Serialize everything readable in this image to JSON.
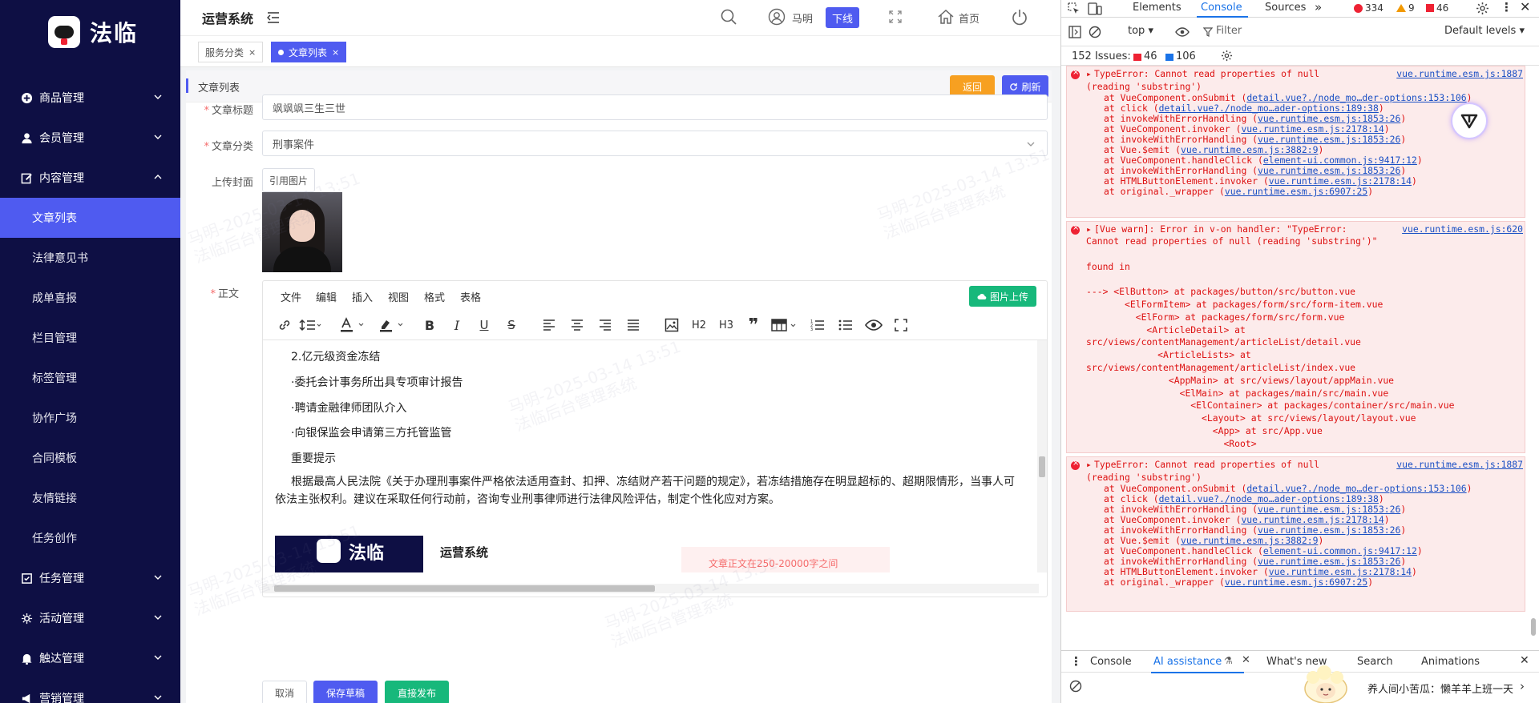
{
  "sidebar": {
    "brand": "法临",
    "groups_top": [
      {
        "label": "商品管理",
        "icon": "plus-circle-icon"
      },
      {
        "label": "会员管理",
        "icon": "user-icon"
      },
      {
        "label": "内容管理",
        "icon": "edit-icon"
      }
    ],
    "content_items": [
      {
        "label": "文章列表",
        "active": true
      },
      {
        "label": "法律意见书"
      },
      {
        "label": "成单喜报"
      },
      {
        "label": "栏目管理"
      },
      {
        "label": "标签管理"
      },
      {
        "label": "协作广场"
      },
      {
        "label": "合同模板"
      },
      {
        "label": "友情链接"
      },
      {
        "label": "任务创作"
      }
    ],
    "groups_bottom": [
      {
        "label": "任务管理",
        "icon": "task-icon"
      },
      {
        "label": "活动管理",
        "icon": "activity-icon"
      },
      {
        "label": "触达管理",
        "icon": "bell-icon"
      },
      {
        "label": "营销管理",
        "icon": "marketing-icon"
      }
    ]
  },
  "header": {
    "title": "运营系统",
    "user": "马明",
    "offline": "下线",
    "home": "首页"
  },
  "tabs": [
    {
      "label": "服务分类",
      "active": false
    },
    {
      "label": "文章列表",
      "active": true
    }
  ],
  "page": {
    "title": "文章列表",
    "back": "返回",
    "refresh": "刷新",
    "form": {
      "title_label": "文章标题",
      "title_value": "飒飒飒三生三世",
      "category_label": "文章分类",
      "category_value": "刑事案件",
      "cover_label": "上传封面",
      "cover_button": "引用图片",
      "body_label": "正文"
    },
    "editor": {
      "menus": [
        "文件",
        "编辑",
        "插入",
        "视图",
        "格式",
        "表格"
      ],
      "image_upload": "图片上传",
      "h2": "H2",
      "h3": "H3",
      "lines": [
        "2.亿元级资金冻结",
        "·委托会计事务所出具专项审计报告",
        "·聘请金融律师团队介入",
        "·向银保监会申请第三方托管监管",
        "重要提示"
      ],
      "paragraph": "根据最高人民法院《关于办理刑事案件严格依法适用查封、扣押、冻结财产若干问题的规定》，若冻结措施存在明显超标的、超期限情形，当事人可依法主张权利。建议在采取任何行动前，咨询专业刑事律师进行法律风险评估，制定个性化应对方案。",
      "embedded_brand": "法临",
      "embedded_title": "运营系统",
      "embedded_error": "文章正文在250-20000字之间"
    },
    "actions": {
      "cancel": "取消",
      "save_draft": "保存草稿",
      "publish": "直接发布"
    },
    "watermark_line1": "马明-2025-03-14 13:51",
    "watermark_line2": "法临后台管理系统"
  },
  "devtools": {
    "tabs": [
      "Elements",
      "Console",
      "Sources"
    ],
    "more": "»",
    "errors": "334",
    "warnings": "9",
    "issues_badge": "46",
    "context": "top",
    "filter_placeholder": "Filter",
    "levels": "Default levels",
    "issues_label": "152 Issues:",
    "issues_errors": "46",
    "issues_info": "106",
    "log1": {
      "msg1": "TypeError: Cannot read properties of null",
      "msg2": "(reading 'substring')",
      "src": "vue.runtime.esm.js:1887",
      "frames": [
        [
          "at VueComponent.onSubmit (",
          "detail.vue?./node_mo…der-options:153:106",
          ")"
        ],
        [
          "at click (",
          "detail.vue?./node_mo…ader-options:189:38",
          ")"
        ],
        [
          "at invokeWithErrorHandling (",
          "vue.runtime.esm.js:1853:26",
          ")"
        ],
        [
          "at VueComponent.invoker (",
          "vue.runtime.esm.js:2178:14",
          ")"
        ],
        [
          "at invokeWithErrorHandling (",
          "vue.runtime.esm.js:1853:26",
          ")"
        ],
        [
          "at Vue.$emit (",
          "vue.runtime.esm.js:3882:9",
          ")"
        ],
        [
          "at VueComponent.handleClick (",
          "element-ui.common.js:9417:12",
          ")"
        ],
        [
          "at invokeWithErrorHandling (",
          "vue.runtime.esm.js:1853:26",
          ")"
        ],
        [
          "at HTMLButtonElement.invoker (",
          "vue.runtime.esm.js:2178:14",
          ")"
        ],
        [
          "at original._wrapper (",
          "vue.runtime.esm.js:6907:25",
          ")"
        ]
      ]
    },
    "log2": {
      "msg1": "[Vue warn]: Error in v-on handler: \"TypeError:",
      "src": "vue.runtime.esm.js:620",
      "lines": [
        "Cannot read properties of null (reading 'substring')\"",
        "",
        "found in",
        "",
        "---> <ElButton> at packages/button/src/button.vue",
        "       <ElFormItem> at packages/form/src/form-item.vue",
        "         <ElForm> at packages/form/src/form.vue",
        "           <ArticleDetail> at",
        "src/views/contentManagement/articleList/detail.vue",
        "             <ArticleLists> at",
        "src/views/contentManagement/articleList/index.vue",
        "               <AppMain> at src/views/layout/appMain.vue",
        "                 <ElMain> at packages/main/src/main.vue",
        "                   <ElContainer> at packages/container/src/main.vue",
        "                     <Layout> at src/views/layout/layout.vue",
        "                       <App> at src/App.vue",
        "                         <Root>"
      ]
    },
    "log3": {
      "msg1": "TypeError: Cannot read properties of null",
      "msg2": "(reading 'substring')",
      "src": "vue.runtime.esm.js:1887"
    },
    "prompt": "›",
    "drawer_tabs": [
      "Console",
      "AI assistance",
      "What's new",
      "Search",
      "Animations"
    ],
    "popup_text": "养人间小苦瓜：懒羊羊上班一天"
  }
}
